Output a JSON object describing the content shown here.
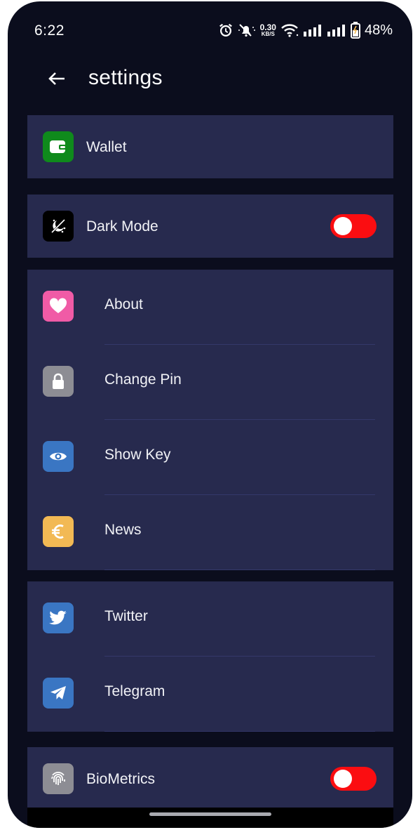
{
  "status_bar": {
    "time": "6:22",
    "net_speed_value": "0.30",
    "net_speed_unit": "KB/S",
    "battery": "48%"
  },
  "app_bar": {
    "title": "settings"
  },
  "sections": {
    "wallet": {
      "label": "Wallet",
      "icon": "wallet-icon",
      "color": "#0f8a1c"
    },
    "dark_mode": {
      "label": "Dark Mode",
      "icon": "dark-mode-icon",
      "color": "#000000",
      "toggle_on": false
    },
    "about": {
      "label": "About",
      "icon": "heart-icon",
      "color": "#f05ba6"
    },
    "change_pin": {
      "label": "Change Pin",
      "icon": "lock-icon",
      "color": "#8d8d94"
    },
    "show_key": {
      "label": "Show Key",
      "icon": "eye-icon",
      "color": "#3a76c3"
    },
    "news": {
      "label": "News",
      "icon": "euro-icon",
      "color": "#f2b954"
    },
    "twitter": {
      "label": "Twitter",
      "icon": "twitter-icon",
      "color": "#3a76c3"
    },
    "telegram": {
      "label": "Telegram",
      "icon": "telegram-icon",
      "color": "#3a76c3"
    },
    "biometrics": {
      "label": "BioMetrics",
      "icon": "fingerprint-icon",
      "color": "#8d8d94",
      "toggle_on": false
    }
  },
  "colors": {
    "background": "#0b0d1d",
    "card": "#272a4e",
    "toggle_off": "#fb0d11"
  }
}
